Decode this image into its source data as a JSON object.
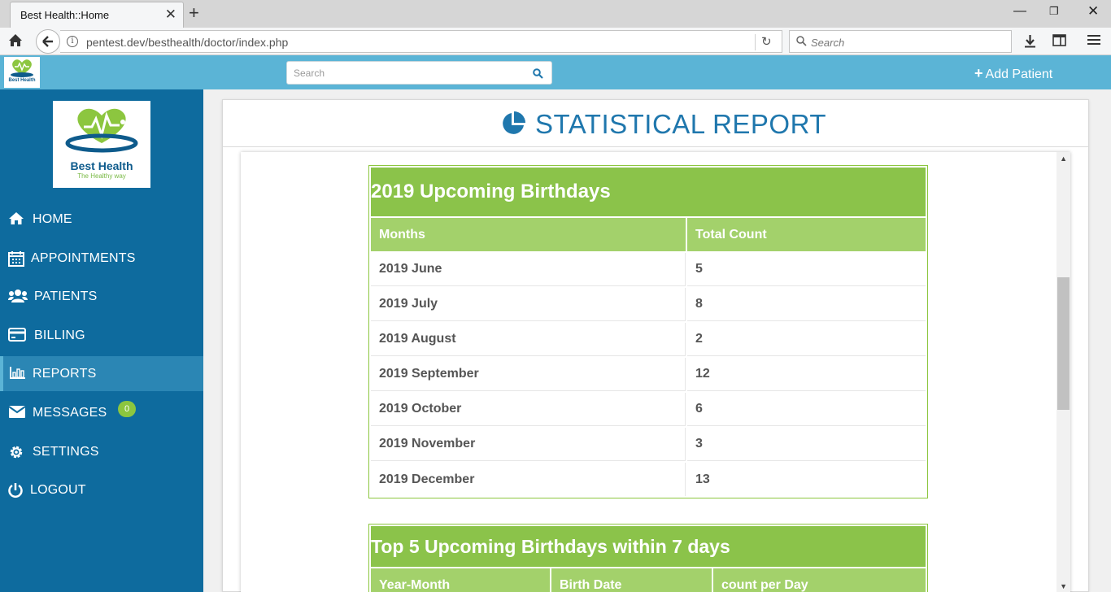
{
  "browser": {
    "tab_title": "Best Health::Home",
    "url": "pentest.dev/besthealth/doctor/index.php",
    "search_placeholder": "Search"
  },
  "header": {
    "search_placeholder": "Search",
    "add_patient_label": "Add Patient"
  },
  "brand": {
    "name": "Best Health",
    "tagline": "The Healthy way",
    "colors": {
      "sidebar": "#0e6b9e",
      "header": "#5bb4d6",
      "green": "#8bc34a"
    }
  },
  "sidebar": {
    "items": [
      {
        "label": "HOME",
        "icon": "home-icon"
      },
      {
        "label": "APPOINTMENTS",
        "icon": "calendar-icon"
      },
      {
        "label": "PATIENTS",
        "icon": "users-icon"
      },
      {
        "label": "BILLING",
        "icon": "credit-card-icon"
      },
      {
        "label": "REPORTS",
        "icon": "bar-chart-icon",
        "active": true
      },
      {
        "label": "MESSAGES",
        "icon": "envelope-icon",
        "badge": "0"
      },
      {
        "label": "SETTINGS",
        "icon": "gear-icon"
      },
      {
        "label": "LOGOUT",
        "icon": "power-icon"
      }
    ]
  },
  "report": {
    "title": "STATISTICAL REPORT",
    "birthdays_table": {
      "caption": "2019 Upcoming Birthdays",
      "columns": [
        "Months",
        "Total Count"
      ],
      "rows": [
        [
          "2019 June",
          "5"
        ],
        [
          "2019 July",
          "8"
        ],
        [
          "2019 August",
          "2"
        ],
        [
          "2019 September",
          "12"
        ],
        [
          "2019 October",
          "6"
        ],
        [
          "2019 November",
          "3"
        ],
        [
          "2019 December",
          "13"
        ]
      ]
    },
    "top5_table": {
      "caption": "Top 5 Upcoming Birthdays within 7 days",
      "columns": [
        "Year-Month",
        "Birth Date",
        "count per Day"
      ]
    }
  }
}
